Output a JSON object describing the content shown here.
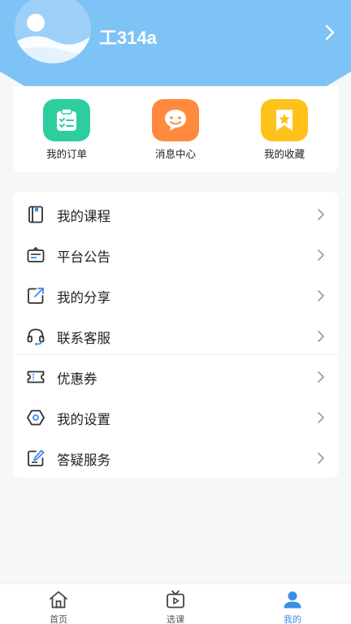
{
  "header": {
    "username": "工314a",
    "colors": {
      "background": "#7ec3f6"
    }
  },
  "quick_actions": [
    {
      "label": "我的订单",
      "icon": "clipboard-check-icon",
      "color": "#2ecda0"
    },
    {
      "label": "消息中心",
      "icon": "chat-smile-icon",
      "color": "#ff8a3d"
    },
    {
      "label": "我的收藏",
      "icon": "bookmark-star-icon",
      "color": "#ffc21a"
    }
  ],
  "menu": [
    {
      "label": "我的课程",
      "icon": "book-icon"
    },
    {
      "label": "平台公告",
      "icon": "notice-board-icon"
    },
    {
      "label": "我的分享",
      "icon": "share-icon"
    },
    {
      "label": "联系客服",
      "icon": "headset-icon"
    },
    {
      "label": "优惠券",
      "icon": "ticket-icon"
    },
    {
      "label": "我的设置",
      "icon": "settings-hexagon-icon"
    },
    {
      "label": "答疑服务",
      "icon": "edit-note-icon"
    }
  ],
  "tabbar": {
    "items": [
      {
        "label": "首页",
        "icon": "home-icon"
      },
      {
        "label": "选课",
        "icon": "video-tv-icon"
      },
      {
        "label": "我的",
        "icon": "user-icon"
      }
    ],
    "active": "我的",
    "colors": {
      "active": "#3b8de6",
      "inactive": "#555555"
    }
  }
}
